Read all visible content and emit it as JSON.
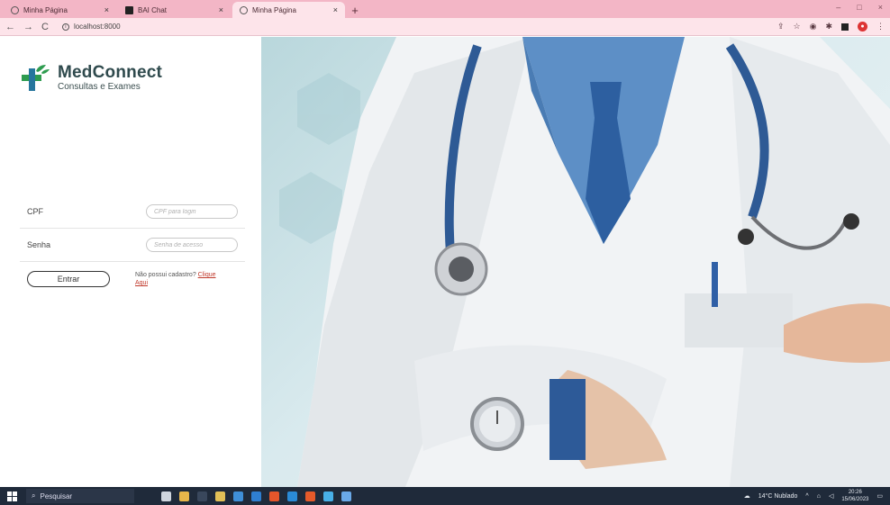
{
  "browser": {
    "tabs": [
      {
        "title": "Minha Página",
        "active": false,
        "close": "×"
      },
      {
        "title": "BAI Chat",
        "active": false,
        "close": "×"
      },
      {
        "title": "Minha Página",
        "active": true,
        "close": "×"
      }
    ],
    "new_tab": "+",
    "url": "localhost:8000",
    "win_minimize": "–",
    "win_maximize": "□",
    "win_close": "×"
  },
  "brand": {
    "name": "MedConnect",
    "tagline": "Consultas e Exames",
    "colors": {
      "green": "#2e9c4f",
      "blue": "#26769d",
      "dark": "#2f4a4d"
    }
  },
  "login": {
    "cpf_label": "CPF",
    "cpf_placeholder": "CPF para login",
    "password_label": "Senha",
    "password_placeholder": "Senha de acesso",
    "enter_button": "Entrar",
    "signup_text": "Não possui cadastro? ",
    "signup_link": "Clique Aqui"
  },
  "taskbar": {
    "search_placeholder": "Pesquisar",
    "weather": "14°C Nublado",
    "time": "20:26",
    "date": "15/06/2023"
  }
}
